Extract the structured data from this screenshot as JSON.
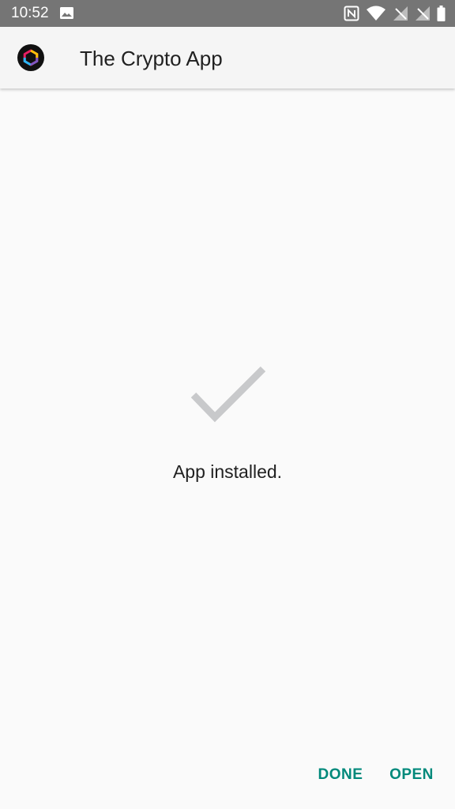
{
  "status_bar": {
    "time": "10:52",
    "icons": [
      "gallery-icon",
      "nfc-icon",
      "wifi-icon",
      "signal-off-icon",
      "signal-off-icon",
      "battery-icon"
    ]
  },
  "app_bar": {
    "title": "The Crypto App",
    "icon": "crypto-app-logo-icon"
  },
  "main": {
    "message": "App installed.",
    "icon": "checkmark-icon"
  },
  "actions": {
    "done_label": "DONE",
    "open_label": "OPEN"
  },
  "colors": {
    "status_bar": "#757575",
    "app_bar": "#f5f5f5",
    "background": "#fafafa",
    "accent": "#00897b",
    "checkmark": "#c8c9cb",
    "text": "#212121"
  }
}
